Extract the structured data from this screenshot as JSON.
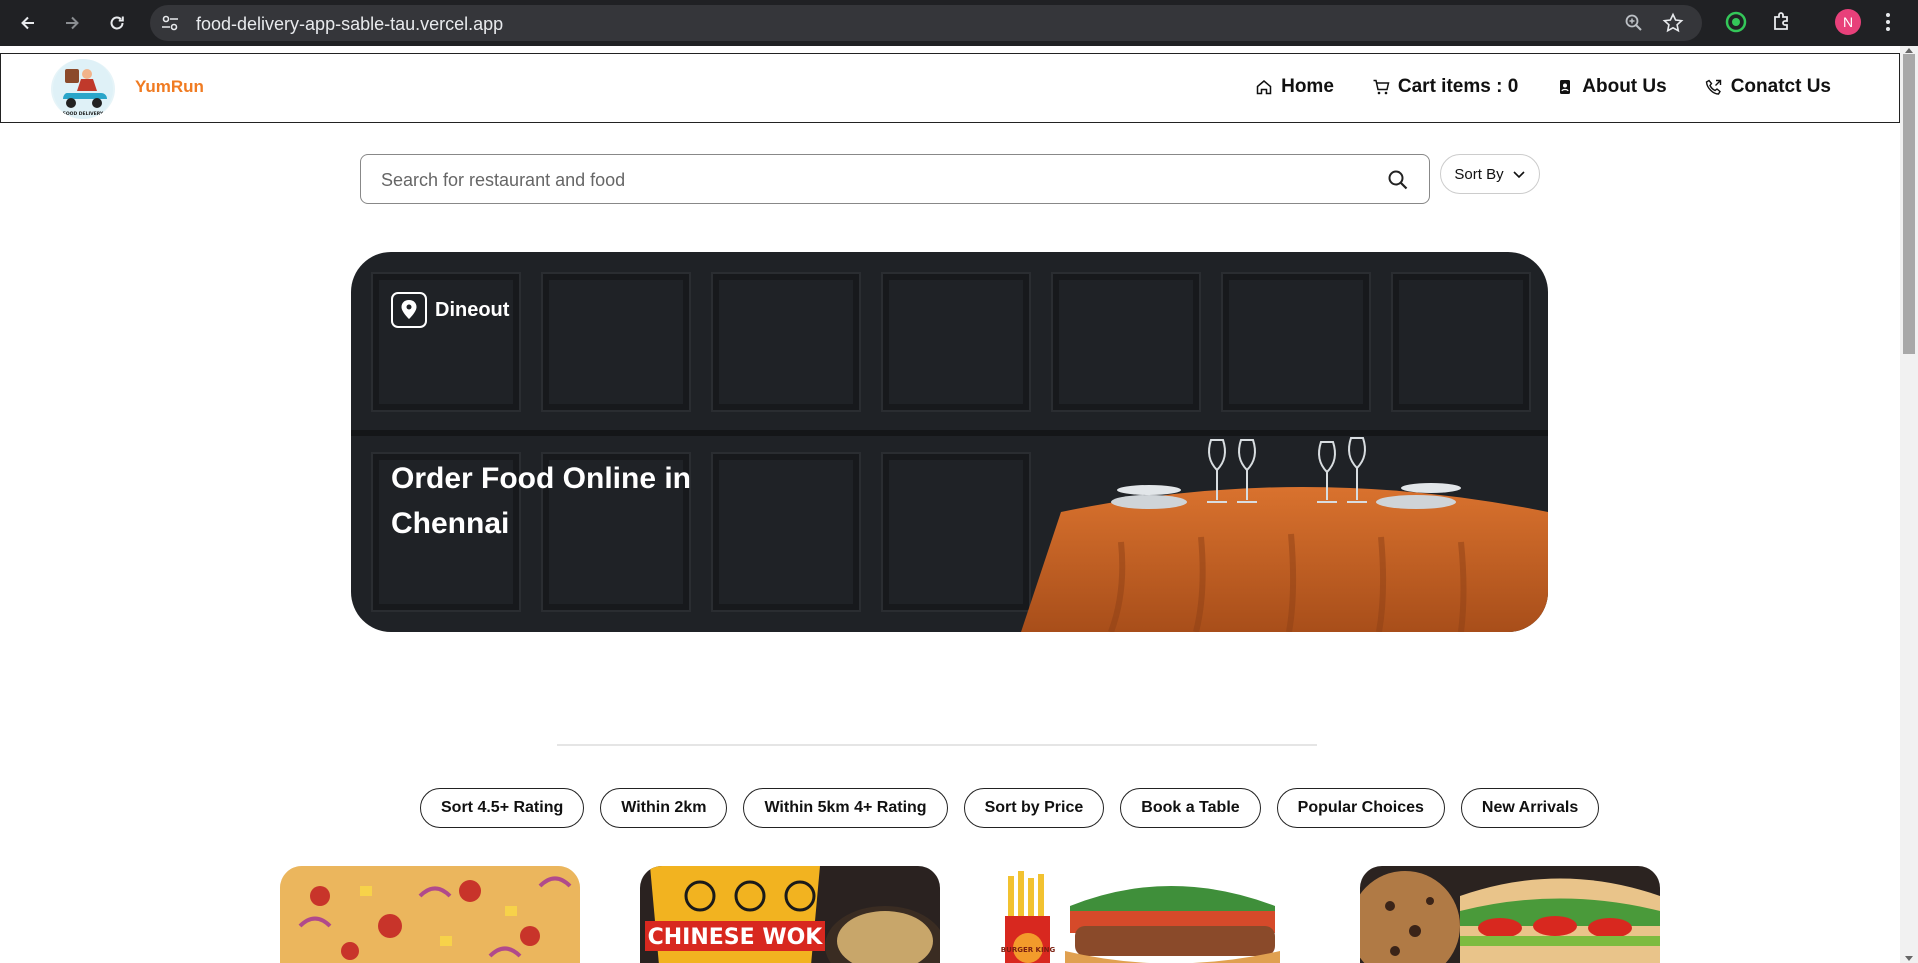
{
  "browser": {
    "url": "food-delivery-app-sable-tau.vercel.app",
    "profile_initial": "N"
  },
  "header": {
    "brand": "YumRun",
    "logo_text": "FOOD DELIVERY",
    "nav": [
      {
        "label": "Home",
        "icon": "home-icon"
      },
      {
        "label": "Cart items : 0",
        "icon": "cart-icon"
      },
      {
        "label": "About Us",
        "icon": "badge-icon"
      },
      {
        "label": "Conatct Us",
        "icon": "phone-icon"
      }
    ]
  },
  "search": {
    "placeholder": "Search for restaurant and food",
    "sort_label": "Sort By"
  },
  "banner": {
    "brand": "Dineout",
    "title": "Order Food Online in Chennai"
  },
  "filters": [
    "Sort 4.5+ Rating",
    "Within 2km",
    "Within 5km 4+ Rating",
    "Sort by Price",
    "Book a Table",
    "Popular Choices",
    "New Arrivals"
  ],
  "cards": [
    {
      "name": "pizza"
    },
    {
      "name": "chinese wok",
      "text": "CHINESE WOK"
    },
    {
      "name": "burger king hot dog",
      "text": "BURGER KING"
    },
    {
      "name": "cookie and sandwich"
    }
  ],
  "colors": {
    "brand": "#f07b22",
    "chrome": "#202124"
  }
}
